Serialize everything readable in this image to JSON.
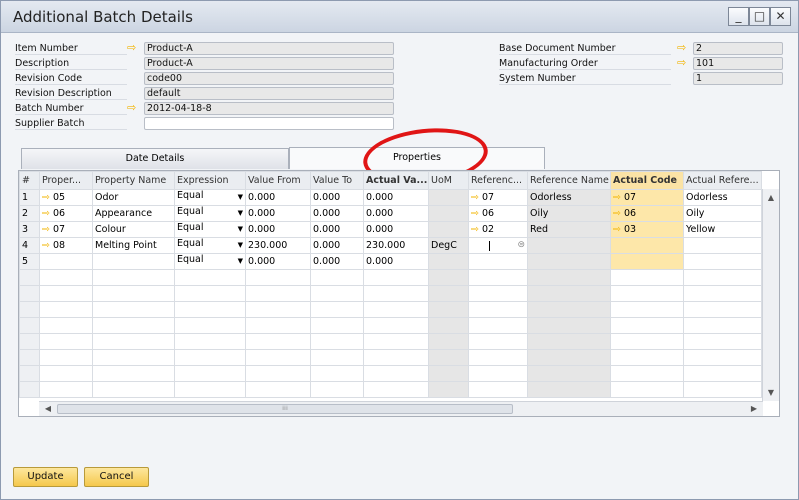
{
  "window": {
    "title": "Additional Batch Details",
    "controls": {
      "minimize": "_",
      "maximize": "□",
      "close": "✕"
    }
  },
  "header": {
    "left_fields": [
      {
        "label": "Item Number",
        "value": "Product-A",
        "has_arrow": true,
        "editable": false
      },
      {
        "label": "Description",
        "value": "Product-A",
        "has_arrow": false,
        "editable": false
      },
      {
        "label": "Revision Code",
        "value": "code00",
        "has_arrow": false,
        "editable": false
      },
      {
        "label": "Revision Description",
        "value": "default",
        "has_arrow": false,
        "editable": false
      },
      {
        "label": "Batch Number",
        "value": "2012-04-18-8",
        "has_arrow": true,
        "editable": false
      },
      {
        "label": "Supplier Batch",
        "value": "",
        "has_arrow": false,
        "editable": true
      }
    ],
    "right_fields": [
      {
        "label": "Base Document Number",
        "value": "2",
        "has_arrow": true
      },
      {
        "label": "Manufacturing Order",
        "value": "101",
        "has_arrow": true
      },
      {
        "label": "System Number",
        "value": "1",
        "has_arrow": false
      }
    ]
  },
  "tabs": [
    {
      "label": "Date Details",
      "active": false
    },
    {
      "label": "Properties",
      "active": true
    }
  ],
  "grid": {
    "columns": [
      "#",
      "Proper...",
      "Property Name",
      "Expression",
      "Value From",
      "Value To",
      "Actual Va...",
      "UoM",
      "Referenc...",
      "Reference Name",
      "Actual Code",
      "Actual Refere..."
    ],
    "rows": [
      {
        "num": "1",
        "prop": "05",
        "name": "Odor",
        "expr": "Equal",
        "from": "0.000",
        "to": "0.000",
        "actual": "0.000",
        "uom": "",
        "ref": "07",
        "refname": "Odorless",
        "code": "07",
        "actref": "Odorless"
      },
      {
        "num": "2",
        "prop": "06",
        "name": "Appearance",
        "expr": "Equal",
        "from": "0.000",
        "to": "0.000",
        "actual": "0.000",
        "uom": "",
        "ref": "06",
        "refname": "Oily",
        "code": "06",
        "actref": "Oily"
      },
      {
        "num": "3",
        "prop": "07",
        "name": "Colour",
        "expr": "Equal",
        "from": "0.000",
        "to": "0.000",
        "actual": "0.000",
        "uom": "",
        "ref": "02",
        "refname": "Red",
        "code": "03",
        "actref": "Yellow"
      },
      {
        "num": "4",
        "prop": "08",
        "name": "Melting Point",
        "expr": "Equal",
        "from": "230.000",
        "to": "0.000",
        "actual": "230.000",
        "uom": "DegC",
        "ref": "",
        "refname": "",
        "code": "",
        "actref": ""
      },
      {
        "num": "5",
        "prop": "",
        "name": "",
        "expr": "Equal",
        "from": "0.000",
        "to": "0.000",
        "actual": "0.000",
        "uom": "",
        "ref": "",
        "refname": "",
        "code": "",
        "actref": ""
      }
    ],
    "empty_rows": 8
  },
  "buttons": {
    "update": "Update",
    "cancel": "Cancel"
  },
  "colors": {
    "accent_arrow": "#f2b400",
    "button_yellow": "#f5c84c",
    "highlight_circle": "#e01515"
  }
}
